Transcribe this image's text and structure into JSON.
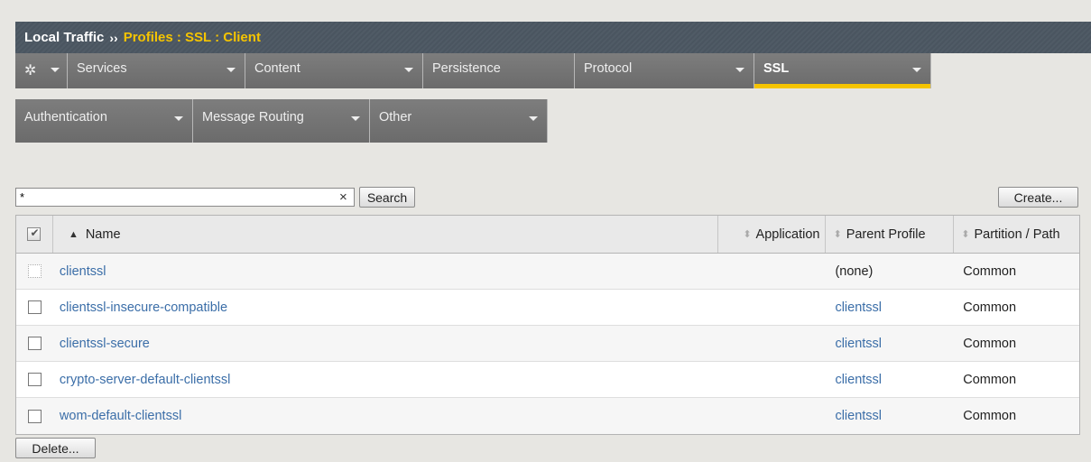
{
  "header": {
    "root": "Local Traffic",
    "separator": "››",
    "active": "Profiles : SSL : Client"
  },
  "menu": {
    "gear_icon": "gear-icon",
    "row1": [
      {
        "label": "Services"
      },
      {
        "label": "Content"
      },
      {
        "label": "Persistence"
      },
      {
        "label": "Protocol"
      },
      {
        "label": "SSL",
        "active": true
      }
    ],
    "row2": [
      {
        "label": "Authentication"
      },
      {
        "label": "Message Routing"
      },
      {
        "label": "Other"
      }
    ]
  },
  "search": {
    "value": "*",
    "clear_symbol": "×",
    "button_label": "Search"
  },
  "create_label": "Create...",
  "delete_label": "Delete...",
  "table": {
    "columns": {
      "name": "Name",
      "application": "Application",
      "parent_profile": "Parent Profile",
      "partition_path": "Partition / Path"
    },
    "rows": [
      {
        "name": "clientssl",
        "application": "",
        "parent": "(none)",
        "partition": "Common"
      },
      {
        "name": "clientssl-insecure-compatible",
        "application": "",
        "parent": "clientssl",
        "partition": "Common"
      },
      {
        "name": "clientssl-secure",
        "application": "",
        "parent": "clientssl",
        "partition": "Common"
      },
      {
        "name": "crypto-server-default-clientssl",
        "application": "",
        "parent": "clientssl",
        "partition": "Common"
      },
      {
        "name": "wom-default-clientssl",
        "application": "",
        "parent": "clientssl",
        "partition": "Common"
      }
    ]
  },
  "colors": {
    "accent": "#f5c400",
    "header_bg": "#4a5560",
    "link": "#3b6ea8"
  }
}
